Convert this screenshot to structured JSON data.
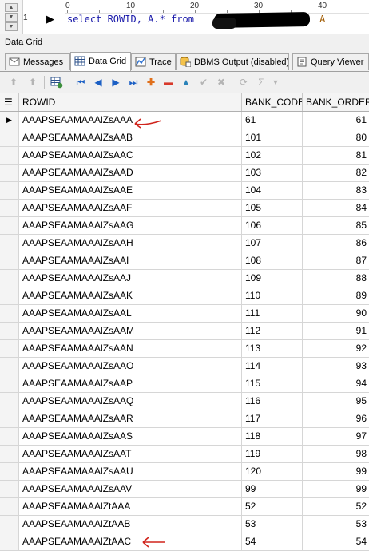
{
  "editor": {
    "ruler": [
      "0",
      "10",
      "20",
      "30",
      "40"
    ],
    "line_number": "1",
    "code": "select ROWID, A.* from ",
    "code_tail": "A"
  },
  "panel_title": "Data Grid",
  "tabs": [
    {
      "label": "Messages",
      "icon": "messages-icon"
    },
    {
      "label": "Data Grid",
      "icon": "grid-icon",
      "active": true
    },
    {
      "label": "Trace",
      "icon": "trace-icon"
    },
    {
      "label": "DBMS Output (disabled)",
      "icon": "dbms-output-icon"
    },
    {
      "label": "Query Viewer",
      "icon": "query-viewer-icon"
    }
  ],
  "toolbar": {
    "sigma": "Σ"
  },
  "grid": {
    "columns": [
      "ROWID",
      "BANK_CODE",
      "BANK_ORDER"
    ],
    "rows": [
      [
        "AAAPSEAAMAAAlZsAAA",
        "61",
        "61"
      ],
      [
        "AAAPSEAAMAAAlZsAAB",
        "101",
        "80"
      ],
      [
        "AAAPSEAAMAAAlZsAAC",
        "102",
        "81"
      ],
      [
        "AAAPSEAAMAAAlZsAAD",
        "103",
        "82"
      ],
      [
        "AAAPSEAAMAAAlZsAAE",
        "104",
        "83"
      ],
      [
        "AAAPSEAAMAAAlZsAAF",
        "105",
        "84"
      ],
      [
        "AAAPSEAAMAAAlZsAAG",
        "106",
        "85"
      ],
      [
        "AAAPSEAAMAAAlZsAAH",
        "107",
        "86"
      ],
      [
        "AAAPSEAAMAAAlZsAAI",
        "108",
        "87"
      ],
      [
        "AAAPSEAAMAAAlZsAAJ",
        "109",
        "88"
      ],
      [
        "AAAPSEAAMAAAlZsAAK",
        "110",
        "89"
      ],
      [
        "AAAPSEAAMAAAlZsAAL",
        "111",
        "90"
      ],
      [
        "AAAPSEAAMAAAlZsAAM",
        "112",
        "91"
      ],
      [
        "AAAPSEAAMAAAlZsAAN",
        "113",
        "92"
      ],
      [
        "AAAPSEAAMAAAlZsAAO",
        "114",
        "93"
      ],
      [
        "AAAPSEAAMAAAlZsAAP",
        "115",
        "94"
      ],
      [
        "AAAPSEAAMAAAlZsAAQ",
        "116",
        "95"
      ],
      [
        "AAAPSEAAMAAAlZsAAR",
        "117",
        "96"
      ],
      [
        "AAAPSEAAMAAAlZsAAS",
        "118",
        "97"
      ],
      [
        "AAAPSEAAMAAAlZsAAT",
        "119",
        "98"
      ],
      [
        "AAAPSEAAMAAAlZsAAU",
        "120",
        "99"
      ],
      [
        "AAAPSEAAMAAAlZsAAV",
        "99",
        "99"
      ],
      [
        "AAAPSEAAMAAAlZtAAA",
        "52",
        "52"
      ],
      [
        "AAAPSEAAMAAAlZtAAB",
        "53",
        "53"
      ],
      [
        "AAAPSEAAMAAAlZtAAC",
        "54",
        "54"
      ]
    ],
    "current_row": 0
  },
  "colors": {
    "annotation_red": "#d0241c",
    "code_blue": "#1a1aaa"
  }
}
